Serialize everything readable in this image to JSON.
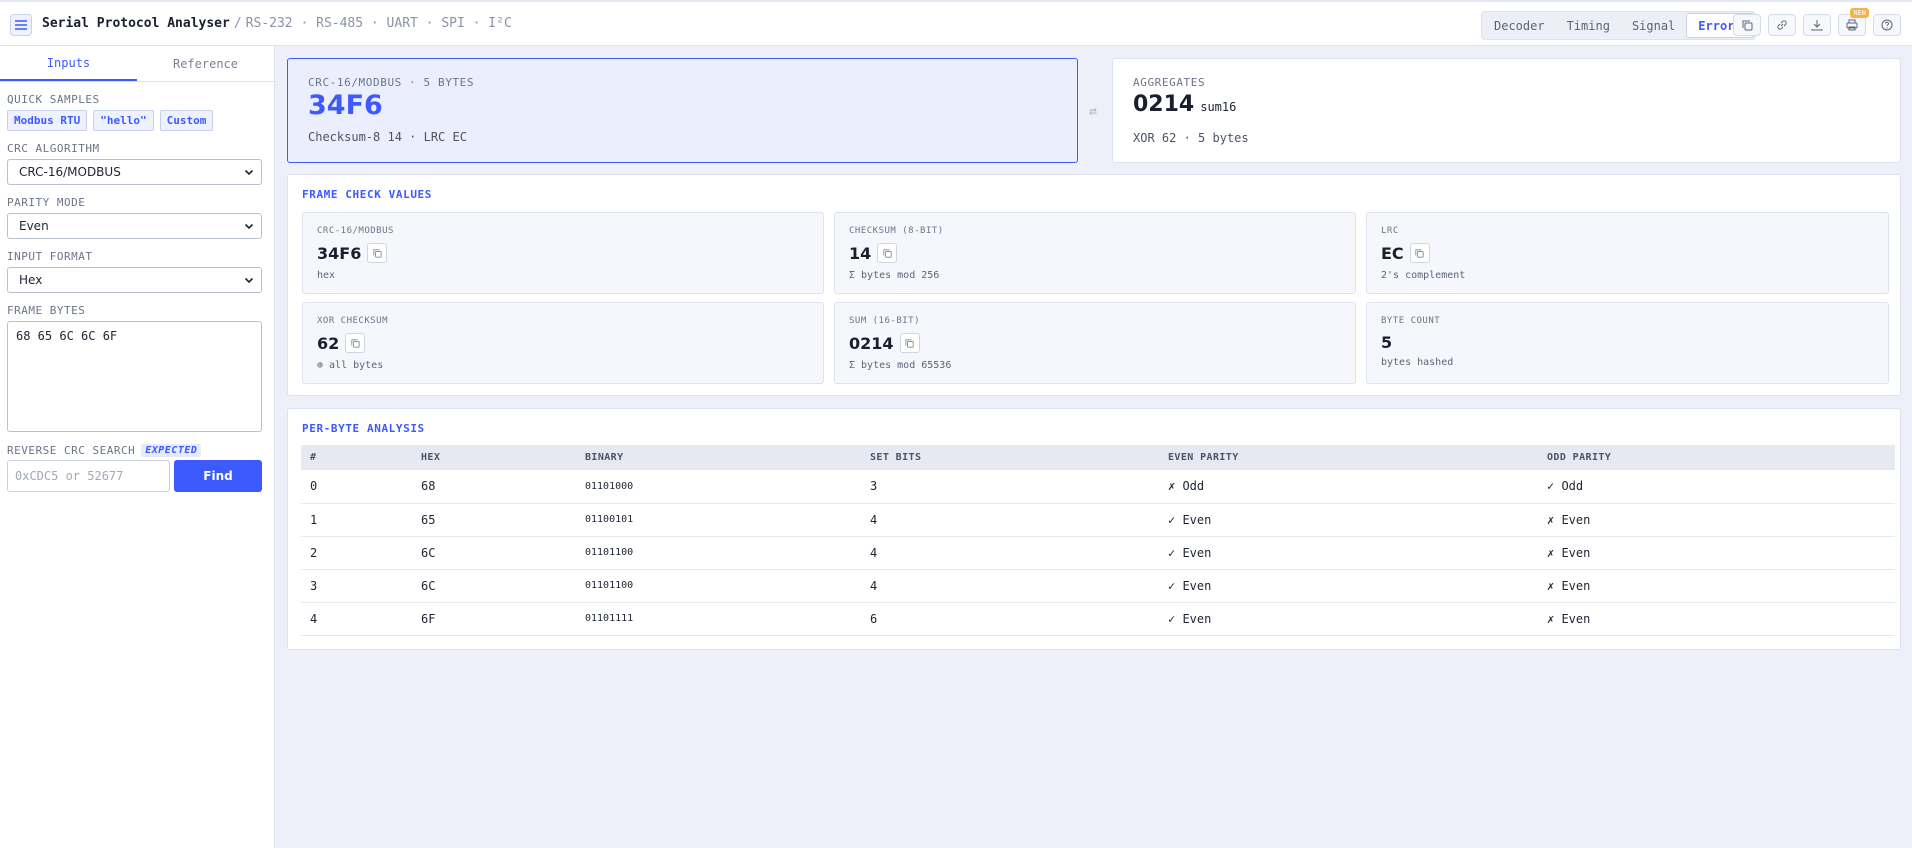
{
  "header": {
    "title": "Serial Protocol Analyser",
    "separator": "/",
    "protocols": "RS-232 · RS-485 · UART · SPI · I²C",
    "tabs": [
      {
        "label": "Decoder",
        "active": false
      },
      {
        "label": "Timing",
        "active": false
      },
      {
        "label": "Signal",
        "active": false
      },
      {
        "label": "Errors",
        "active": true
      }
    ],
    "badge": "NEW"
  },
  "sidebar": {
    "tabs": [
      {
        "label": "Inputs",
        "active": true
      },
      {
        "label": "Reference",
        "active": false
      }
    ],
    "quick_samples_label": "QUICK SAMPLES",
    "samples": [
      "Modbus RTU",
      "\"hello\"",
      "Custom"
    ],
    "crc_label": "CRC ALGORITHM",
    "crc_value": "CRC-16/MODBUS",
    "parity_label": "PARITY MODE",
    "parity_value": "Even",
    "format_label": "INPUT FORMAT",
    "format_value": "Hex",
    "frame_label": "FRAME BYTES",
    "frame_value": "68 65 6C 6C 6F",
    "reverse_label": "REVERSE CRC SEARCH",
    "expected_tag": "EXPECTED",
    "reverse_placeholder": "0xCDC5 or 52677",
    "find_label": "Find"
  },
  "summary": {
    "primary_caption": "CRC-16/MODBUS · 5 BYTES",
    "primary_value": "34F6",
    "primary_sub": "Checksum-8 14 · LRC EC",
    "aggregates_caption": "AGGREGATES",
    "aggregates_value": "0214",
    "aggregates_unit": "sum16",
    "aggregates_sub": "XOR 62 · 5 bytes"
  },
  "frame_check": {
    "title": "FRAME CHECK VALUES",
    "items": [
      {
        "label": "CRC-16/MODBUS",
        "value": "34F6",
        "sub": "hex"
      },
      {
        "label": "CHECKSUM (8-BIT)",
        "value": "14",
        "sub": "Σ bytes mod 256"
      },
      {
        "label": "LRC",
        "value": "EC",
        "sub": "2's complement"
      },
      {
        "label": "XOR CHECKSUM",
        "value": "62",
        "sub": "⊕ all bytes"
      },
      {
        "label": "SUM (16-BIT)",
        "value": "0214",
        "sub": "Σ bytes mod 65536"
      },
      {
        "label": "BYTE COUNT",
        "value": "5",
        "sub": "bytes hashed"
      }
    ]
  },
  "per_byte": {
    "title": "PER-BYTE ANALYSIS",
    "columns": [
      "#",
      "HEX",
      "BINARY",
      "SET BITS",
      "EVEN PARITY",
      "ODD PARITY"
    ],
    "rows": [
      [
        "0",
        "68",
        "01101000",
        "3",
        "✗ Odd",
        "✓ Odd"
      ],
      [
        "1",
        "65",
        "01100101",
        "4",
        "✓ Even",
        "✗ Even"
      ],
      [
        "2",
        "6C",
        "01101100",
        "4",
        "✓ Even",
        "✗ Even"
      ],
      [
        "3",
        "6C",
        "01101100",
        "4",
        "✓ Even",
        "✗ Even"
      ],
      [
        "4",
        "6F",
        "01101111",
        "6",
        "✓ Even",
        "✗ Even"
      ]
    ]
  },
  "colors": {
    "accent": "#3d5afe",
    "badge": "#f5b14a"
  }
}
